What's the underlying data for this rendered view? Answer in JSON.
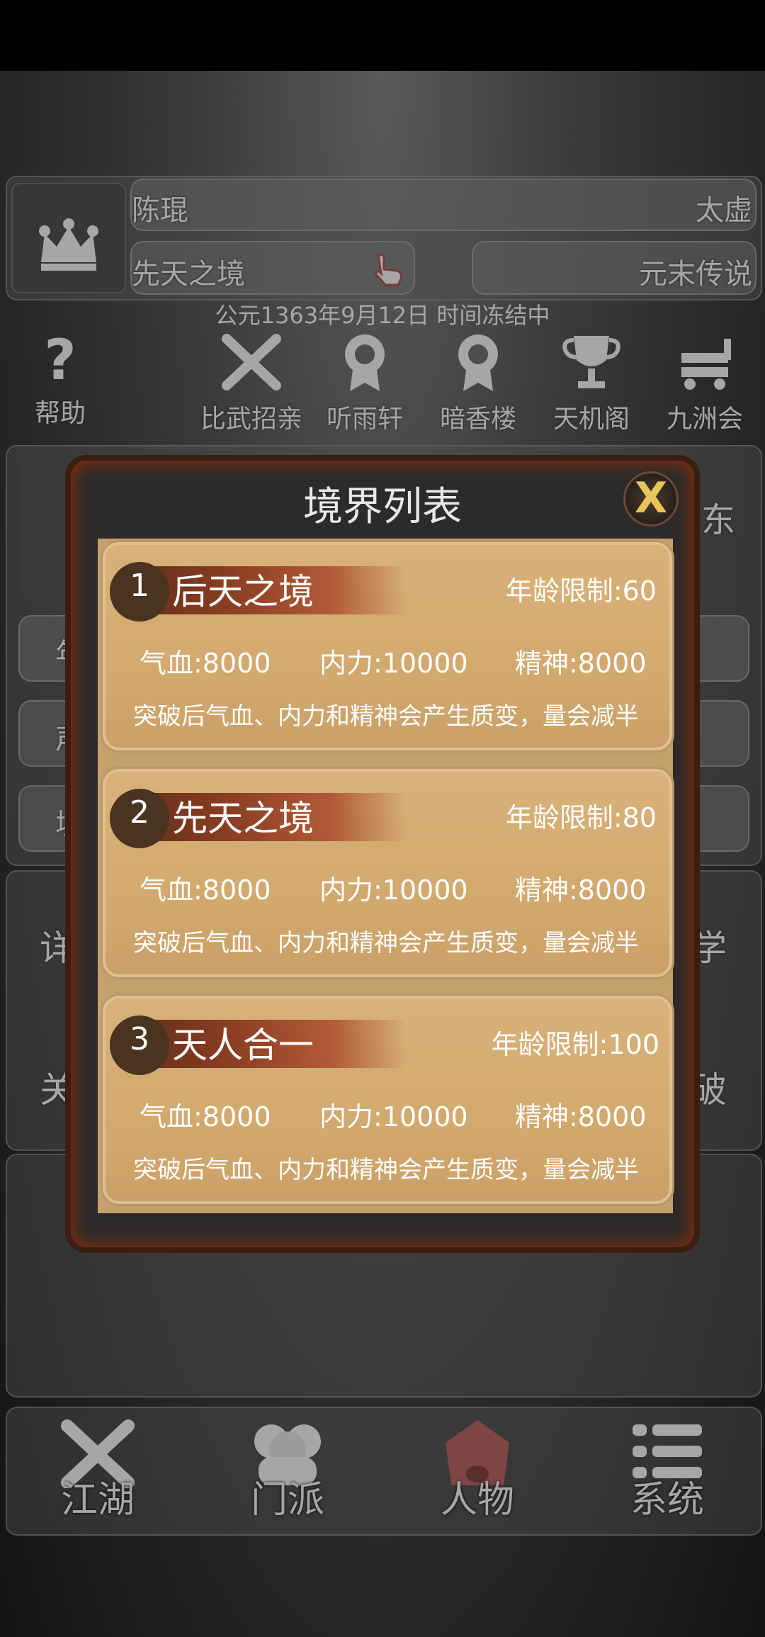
{
  "header": {
    "player_name": "陈琨",
    "right_title": "太虚",
    "realm_button": "先天之境",
    "legend_button": "元末传说",
    "date_status": "公元1363年9月12日 时间冻结中"
  },
  "top_menu": [
    {
      "label": "帮助",
      "icon": "question-icon"
    },
    {
      "label": "比武招亲",
      "icon": "crossed-swords-icon"
    },
    {
      "label": "听雨轩",
      "icon": "rosette-icon"
    },
    {
      "label": "暗香楼",
      "icon": "rosette-icon"
    },
    {
      "label": "天机阁",
      "icon": "trophy-icon"
    },
    {
      "label": "九洲会",
      "icon": "cart-icon"
    }
  ],
  "background_fragments": {
    "left_1": "年",
    "left_2": "声",
    "left_3": "境",
    "left_4": "详",
    "left_5": "关",
    "right_1": "东",
    "right_2": "学",
    "right_3": "破"
  },
  "modal": {
    "title": "境界列表",
    "close_label": "X",
    "realms": [
      {
        "index": "1",
        "name": "后天之境",
        "age_limit": "年龄限制:60",
        "hp": "气血:8000",
        "internal": "内力:10000",
        "spirit": "精神:8000",
        "note": "突破后气血、内力和精神会产生质变，量会减半"
      },
      {
        "index": "2",
        "name": "先天之境",
        "age_limit": "年龄限制:80",
        "hp": "气血:8000",
        "internal": "内力:10000",
        "spirit": "精神:8000",
        "note": "突破后气血、内力和精神会产生质变，量会减半"
      },
      {
        "index": "3",
        "name": "天人合一",
        "age_limit": "年龄限制:100",
        "hp": "气血:8000",
        "internal": "内力:10000",
        "spirit": "精神:8000",
        "note": "突破后气血、内力和精神会产生质变，量会减半"
      }
    ]
  },
  "bottom_nav": [
    {
      "label": "江湖",
      "icon": "crossed-swords-icon"
    },
    {
      "label": "门派",
      "icon": "group-icon"
    },
    {
      "label": "人物",
      "icon": "person-icon",
      "active": true
    },
    {
      "label": "系统",
      "icon": "list-icon"
    }
  ],
  "colors": {
    "active_nav": "#c46a6a",
    "card_fill": "#d4ab70",
    "brush_stroke": "#8a3e22"
  }
}
